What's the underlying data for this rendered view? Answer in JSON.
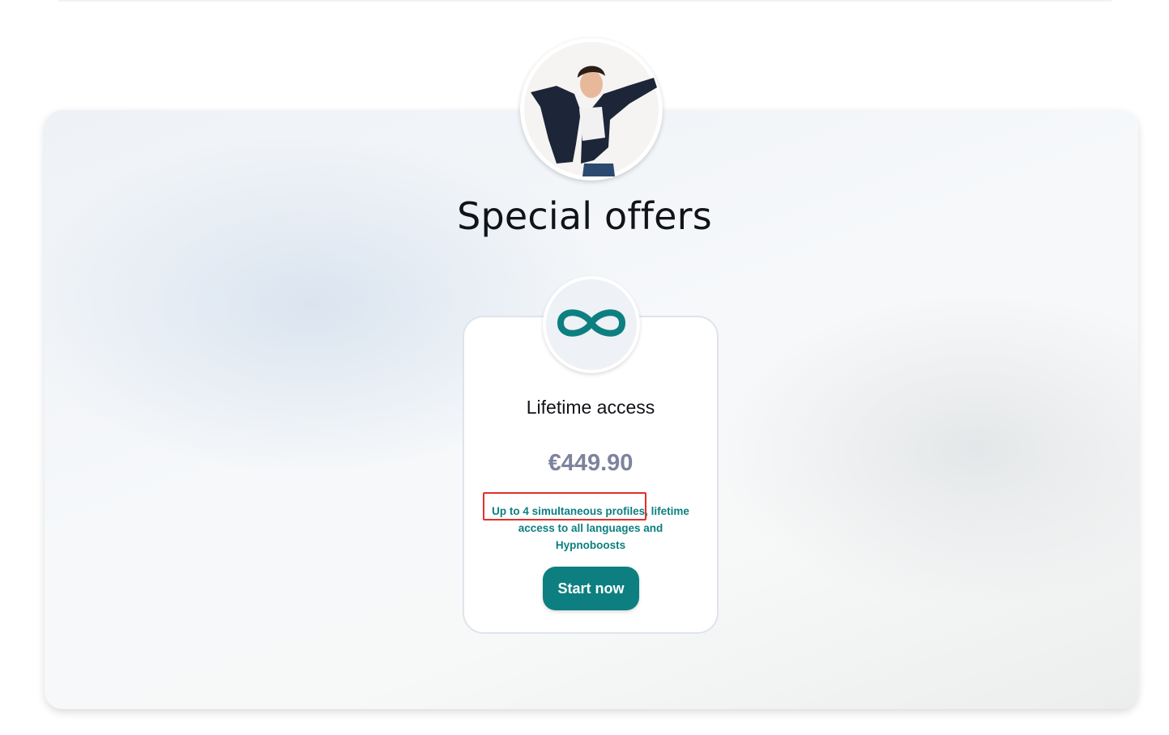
{
  "page": {
    "title": "Special offers"
  },
  "hero": {
    "image": "person-jumping-photo"
  },
  "offer": {
    "icon": "infinity-icon",
    "title": "Lifetime access",
    "price": "€449.90",
    "description_highlight": "Up to 4 simultaneous profiles",
    "description_rest": ", lifetime access to all languages and Hypnoboosts",
    "cta_label": "Start now"
  },
  "colors": {
    "accent": "#0d7f80",
    "price": "#7d839e",
    "highlight_box": "#e0302a"
  }
}
